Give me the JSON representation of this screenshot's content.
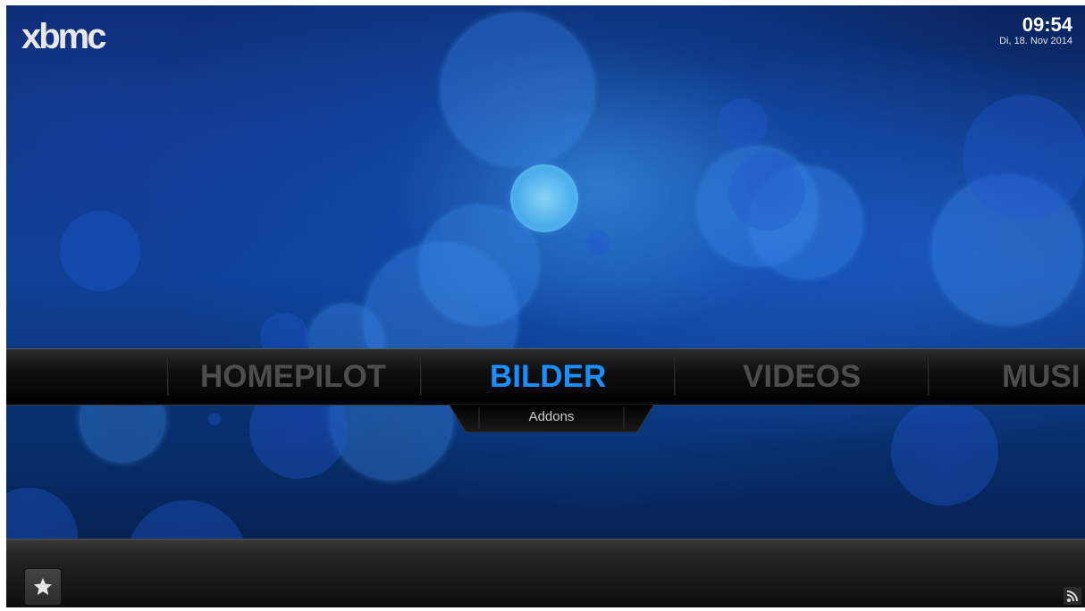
{
  "header": {
    "logo_text": "xbmc",
    "time": "09:54",
    "date": "Di, 18. Nov 2014"
  },
  "main_menu": {
    "items": [
      {
        "label": "HOMEPILOT",
        "state": "inactive"
      },
      {
        "label": "BILDER",
        "state": "selected"
      },
      {
        "label": "VIDEOS",
        "state": "inactive"
      },
      {
        "label": "MUSI",
        "state": "inactive"
      }
    ],
    "selected_color": "#1a8fff",
    "inactive_color": "#4d4d4d"
  },
  "submenu": {
    "label": "Addons"
  },
  "bottom_bar": {
    "favourites_icon": "star-icon",
    "feed_icon": "rss-icon"
  }
}
